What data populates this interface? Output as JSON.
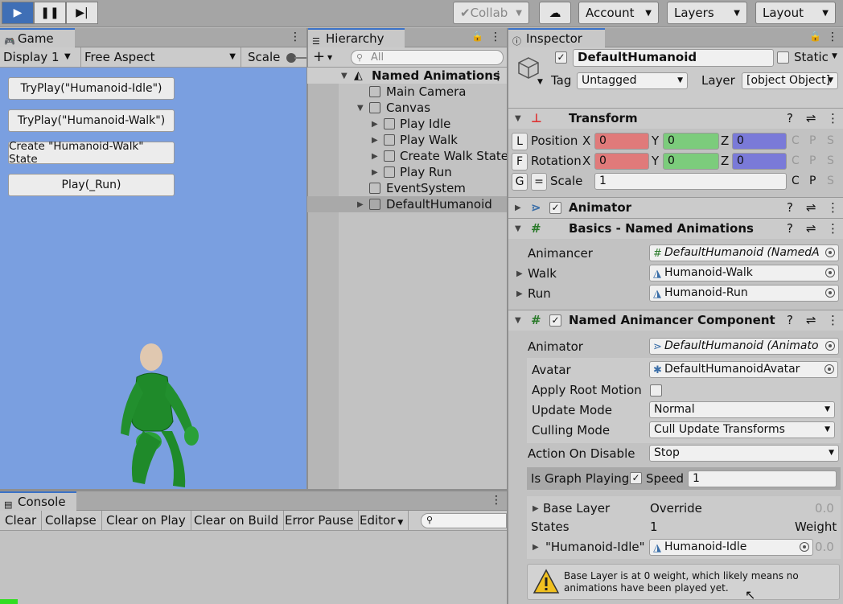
{
  "toolbar": {
    "collab": "Collab",
    "account": "Account",
    "layers": "Layers",
    "layout": "Layout"
  },
  "game": {
    "tab": "Game",
    "display": "Display 1",
    "aspect": "Free Aspect",
    "scale": "Scale",
    "buttons": [
      "TryPlay(\"Humanoid-Idle\")",
      "TryPlay(\"Humanoid-Walk\")",
      "Create \"Humanoid-Walk\" State",
      "Play(_Run)"
    ]
  },
  "hierarchy": {
    "tab": "Hierarchy",
    "search_placeholder": "All",
    "root": "Named Animations",
    "items": [
      "Main Camera",
      "Canvas",
      "Play Idle",
      "Play Walk",
      "Create Walk State",
      "Play Run",
      "EventSystem",
      "DefaultHumanoid"
    ]
  },
  "console": {
    "tab": "Console",
    "buttons": [
      "Clear",
      "Collapse",
      "Clear on Play",
      "Clear on Build",
      "Error Pause",
      "Editor"
    ]
  },
  "inspector": {
    "tab": "Inspector",
    "object_name": "DefaultHumanoid",
    "static": "Static",
    "tag_label": "Tag",
    "tag": "Untagged",
    "layer_label": "Layer",
    "layer": {
      "name": "Base Layer",
      "mode": "Override",
      "mode_val": "0.0",
      "states_label": "States",
      "states": "1",
      "weight": "Weight",
      "state_name": "\"Humanoid-Idle\"",
      "state_clip": "Humanoid-Idle",
      "state_val": "0.0"
    },
    "transform": {
      "title": "Transform",
      "position": "Position",
      "rotation": "Rotation",
      "scale": "Scale",
      "x": "X",
      "y": "Y",
      "z": "Z",
      "px": "0",
      "py": "0",
      "pz": "0",
      "rx": "0",
      "ry": "0",
      "rz": "0",
      "s": "1",
      "l": "L",
      "f": "F",
      "g": "G",
      "eq": "=",
      "c": "C",
      "p": "P",
      "sx": "S"
    },
    "animator": "Animator",
    "basics": {
      "title": "Basics - Named Animations",
      "animancer_label": "Animancer",
      "animancer": "DefaultHumanoid (NamedA",
      "walk_label": "Walk",
      "walk": "Humanoid-Walk",
      "run_label": "Run",
      "run": "Humanoid-Run"
    },
    "named": {
      "title": "Named Animancer Component",
      "animator_label": "Animator",
      "animator": "DefaultHumanoid (Animato",
      "avatar_label": "Avatar",
      "avatar": "DefaultHumanoidAvatar",
      "apply_root": "Apply Root Motion",
      "update_label": "Update Mode",
      "update": "Normal",
      "culling_label": "Culling Mode",
      "culling": "Cull Update Transforms",
      "disable_label": "Action On Disable",
      "disable": "Stop",
      "graph_label": "Is Graph Playing",
      "speed_label": "Speed",
      "speed": "1"
    },
    "warning": "Base Layer is at 0 weight, which likely means no animations have been played yet."
  },
  "colors": {
    "game_bg": "#7a9fe0",
    "x": "#e07a7a",
    "y": "#7ccc7c",
    "z": "#7a7ad8",
    "accent": "#3a72c8"
  }
}
